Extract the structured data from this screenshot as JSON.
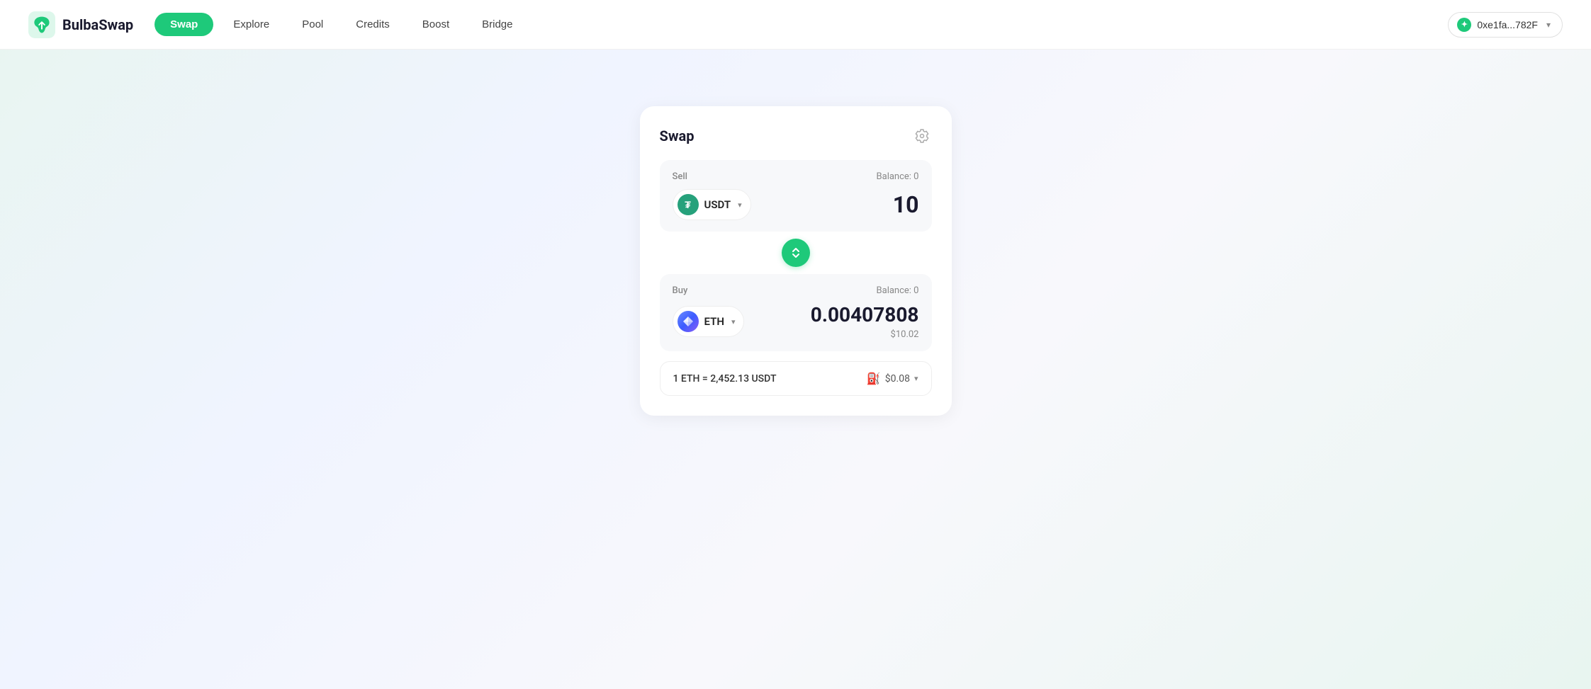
{
  "brand": {
    "name": "BulbaSwap",
    "logo_alt": "BulbaSwap logo"
  },
  "navbar": {
    "links": [
      {
        "label": "Swap",
        "active": true
      },
      {
        "label": "Explore",
        "active": false
      },
      {
        "label": "Pool",
        "active": false
      },
      {
        "label": "Credits",
        "active": false
      },
      {
        "label": "Boost",
        "active": false
      },
      {
        "label": "Bridge",
        "active": false
      }
    ],
    "wallet": {
      "address": "0xe1fa...782F",
      "chevron": "▾"
    }
  },
  "swap_card": {
    "title": "Swap",
    "settings_label": "⚙",
    "sell_section": {
      "label": "Sell",
      "balance_label": "Balance: 0",
      "token": {
        "symbol": "USDT",
        "icon_letter": "₮"
      },
      "amount": "10"
    },
    "swap_direction_icon": "⇅",
    "buy_section": {
      "label": "Buy",
      "balance_label": "Balance: 0",
      "token": {
        "symbol": "ETH",
        "icon": "◆"
      },
      "amount": "0.00407808",
      "usd_value": "$10.02"
    },
    "rate_bar": {
      "rate_text": "1 ETH = 2,452.13 USDT",
      "gas_icon": "⛽",
      "gas_cost": "$0.08",
      "chevron": "▾"
    }
  },
  "colors": {
    "accent_green": "#1ec97a",
    "bg_light": "#f7f8fa",
    "text_dark": "#1a1a2e",
    "text_muted": "#888"
  }
}
